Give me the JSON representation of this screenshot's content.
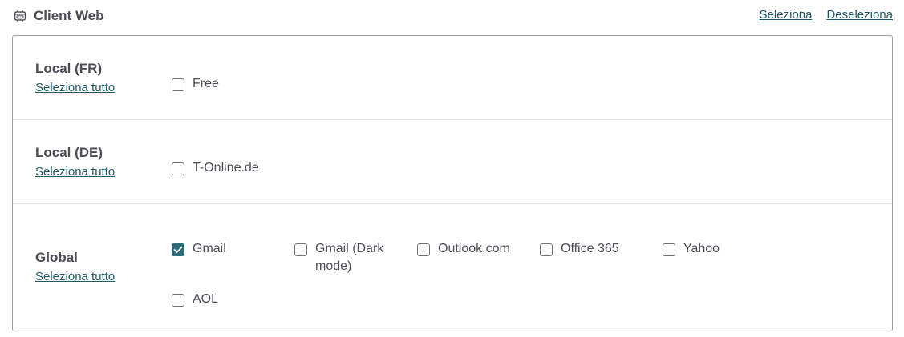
{
  "header": {
    "title": "Client Web",
    "icon": "web-browser-icon",
    "select_label": "Seleziona",
    "deselect_label": "Deseleziona"
  },
  "colors": {
    "accent": "#2c6a7a",
    "link": "#1e5a66",
    "text": "#4a4f55",
    "border": "#9aa0a5"
  },
  "groups": [
    {
      "label": "Local (FR)",
      "select_all": "Seleziona tutto",
      "options": [
        {
          "label": "Free",
          "checked": false
        }
      ]
    },
    {
      "label": "Local (DE)",
      "select_all": "Seleziona tutto",
      "options": [
        {
          "label": "T-Online.de",
          "checked": false
        }
      ]
    },
    {
      "label": "Global",
      "select_all": "Seleziona tutto",
      "options": [
        {
          "label_line1": "Gmail",
          "checked": true
        },
        {
          "label_line1": "Gmail (Dark",
          "label_line2": "mode)",
          "checked": false
        },
        {
          "label_line1": "Outlook.com",
          "checked": false
        },
        {
          "label_line1": "Office 365",
          "checked": false
        },
        {
          "label_line1": "Yahoo",
          "checked": false
        },
        {
          "label_line1": "AOL",
          "checked": false
        }
      ]
    }
  ]
}
